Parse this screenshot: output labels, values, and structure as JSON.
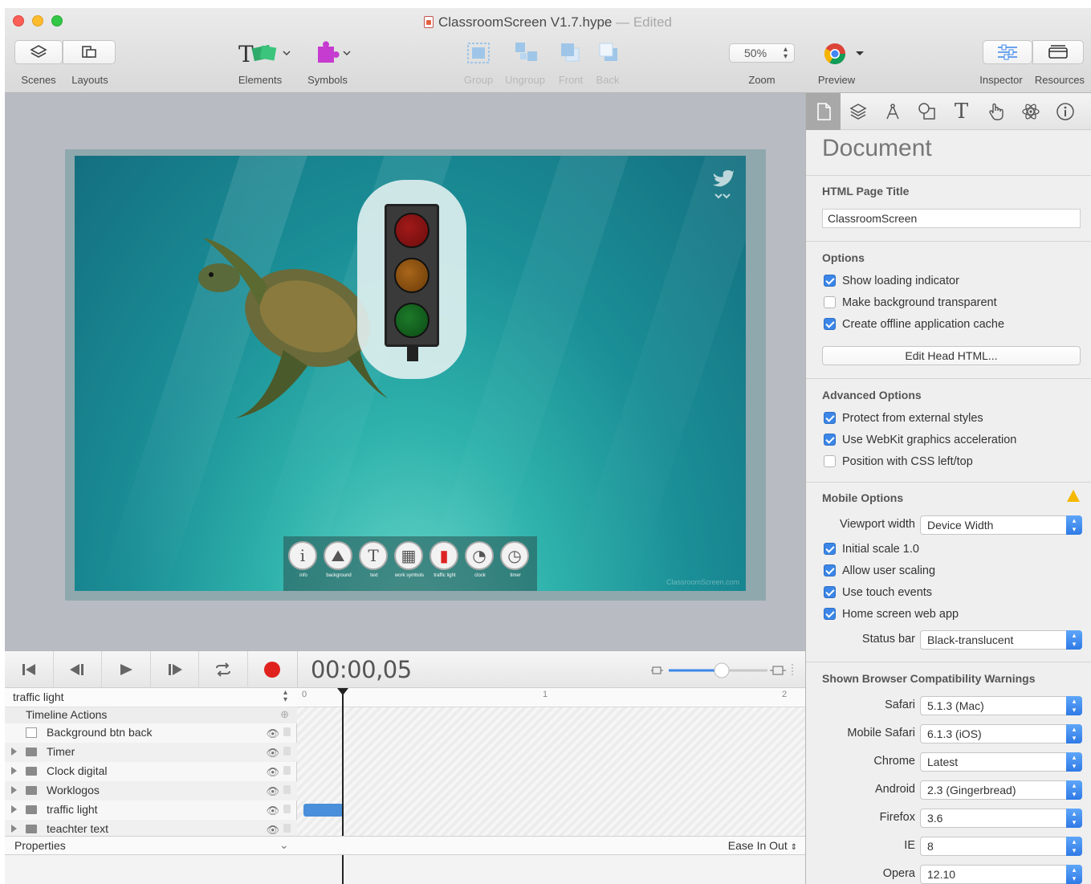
{
  "window": {
    "title": "ClassroomScreen V1.7.hype",
    "title_sep": " — ",
    "status": "Edited"
  },
  "toolbar": {
    "scenes": "Scenes",
    "layouts": "Layouts",
    "elements": "Elements",
    "symbols": "Symbols",
    "group": "Group",
    "ungroup": "Ungroup",
    "front": "Front",
    "back": "Back",
    "zoom_value": "50%",
    "zoom": "Zoom",
    "preview": "Preview",
    "inspector": "Inspector",
    "resources": "Resources"
  },
  "scene": {
    "dock": [
      {
        "glyph": "i",
        "label": "info"
      },
      {
        "glyph": "⛰",
        "label": "background"
      },
      {
        "glyph": "T",
        "label": "text"
      },
      {
        "glyph": "▦",
        "label": "work symbols"
      },
      {
        "glyph": "▮",
        "label": "traffic light"
      },
      {
        "glyph": "◔",
        "label": "clock"
      },
      {
        "glyph": "◷",
        "label": "timer"
      }
    ],
    "watermark": "ClassroomScreen.com"
  },
  "timeline": {
    "timecode": "00:00,05",
    "current_timeline": "traffic light",
    "timeline_actions": "Timeline Actions",
    "ruler_ticks": [
      "0",
      "1",
      "2"
    ],
    "layers": [
      {
        "name": "Background btn back",
        "type": "element"
      },
      {
        "name": "Timer",
        "type": "group"
      },
      {
        "name": "Clock digital",
        "type": "group"
      },
      {
        "name": "Worklogos",
        "type": "group"
      },
      {
        "name": "traffic light",
        "type": "group"
      },
      {
        "name": "teachter text",
        "type": "group"
      }
    ],
    "properties": "Properties",
    "easing": "Ease In Out"
  },
  "inspector": {
    "title": "Document",
    "html_page_title_label": "HTML Page Title",
    "html_page_title_value": "ClassroomScreen",
    "options_header": "Options",
    "options": [
      {
        "label": "Show loading indicator",
        "checked": true
      },
      {
        "label": "Make background transparent",
        "checked": false
      },
      {
        "label": "Create offline application cache",
        "checked": true
      }
    ],
    "edit_head_html": "Edit Head HTML...",
    "advanced_header": "Advanced Options",
    "advanced": [
      {
        "label": "Protect from external styles",
        "checked": true
      },
      {
        "label": "Use WebKit graphics acceleration",
        "checked": true
      },
      {
        "label": "Position with CSS left/top",
        "checked": false
      }
    ],
    "mobile_header": "Mobile Options",
    "viewport_label": "Viewport width",
    "viewport_value": "Device Width",
    "mobile": [
      {
        "label": "Initial scale 1.0",
        "checked": true
      },
      {
        "label": "Allow user scaling",
        "checked": true
      },
      {
        "label": "Use touch events",
        "checked": true
      },
      {
        "label": "Home screen web app",
        "checked": true
      }
    ],
    "status_bar_label": "Status bar",
    "status_bar_value": "Black-translucent",
    "compat_header": "Shown Browser Compatibility Warnings",
    "compat": [
      {
        "label": "Safari",
        "value": "5.1.3 (Mac)"
      },
      {
        "label": "Mobile Safari",
        "value": "6.1.3 (iOS)"
      },
      {
        "label": "Chrome",
        "value": "Latest"
      },
      {
        "label": "Android",
        "value": "2.3 (Gingerbread)"
      },
      {
        "label": "Firefox",
        "value": "3.6"
      },
      {
        "label": "IE",
        "value": "8"
      },
      {
        "label": "Opera",
        "value": "12.10"
      }
    ]
  },
  "colors": {
    "accent": "#3b86e8",
    "record": "#e0221e",
    "warning": "#f5b800"
  }
}
